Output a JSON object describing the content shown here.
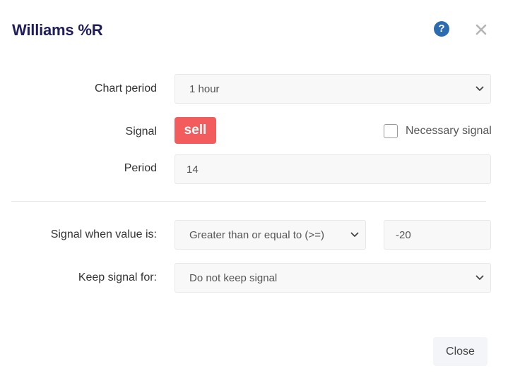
{
  "dialog": {
    "title": "Williams %R",
    "help_icon": "question-circle-icon",
    "help_glyph": "?",
    "close_icon": "close-x-icon"
  },
  "form": {
    "chart_period": {
      "label": "Chart period",
      "value": "1 hour"
    },
    "signal": {
      "label": "Signal",
      "badge": "sell",
      "badge_color": "#f25c5c"
    },
    "necessary_signal": {
      "label": "Necessary signal",
      "checked": false
    },
    "period": {
      "label": "Period",
      "value": "14"
    },
    "condition": {
      "label": "Signal when value is:",
      "operator": "Greater than or equal to (>=)",
      "threshold": "-20"
    },
    "keep_signal": {
      "label": "Keep signal for:",
      "value": "Do not keep signal"
    }
  },
  "footer": {
    "close_label": "Close"
  },
  "colors": {
    "title": "#1f1d5c",
    "help_icon": "#2b6cb0",
    "sell": "#f25c5c"
  }
}
